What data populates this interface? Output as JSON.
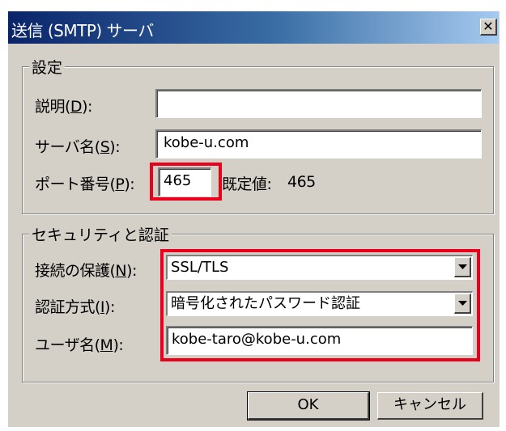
{
  "window": {
    "title": "送信 (SMTP) サーバ",
    "close_glyph": "✕"
  },
  "settings_group": {
    "legend": "設定",
    "description": {
      "label_pre": "説明(",
      "accel": "D",
      "label_post": "):",
      "value": ""
    },
    "server_name": {
      "label_pre": "サーバ名(",
      "accel": "S",
      "label_post": "):",
      "value": "kobe-u.com"
    },
    "port": {
      "label_pre": "ポート番号(",
      "accel": "P",
      "label_post": "):",
      "value": "465",
      "default_label": "既定値:",
      "default_value": "465"
    }
  },
  "security_group": {
    "legend": "セキュリティと認証",
    "connection_security": {
      "label_pre": "接続の保護(",
      "accel": "N",
      "label_post": "):",
      "selected": "SSL/TLS"
    },
    "auth_method": {
      "label_pre": "認証方式(",
      "accel": "I",
      "label_post": "):",
      "selected": "暗号化されたパスワード認証"
    },
    "username": {
      "label_pre": "ユーザ名(",
      "accel": "M",
      "label_post": "):",
      "value": "kobe-taro@kobe-u.com"
    }
  },
  "buttons": {
    "ok": "OK",
    "cancel": "キャンセル"
  },
  "highlight_color": "#e8001c"
}
